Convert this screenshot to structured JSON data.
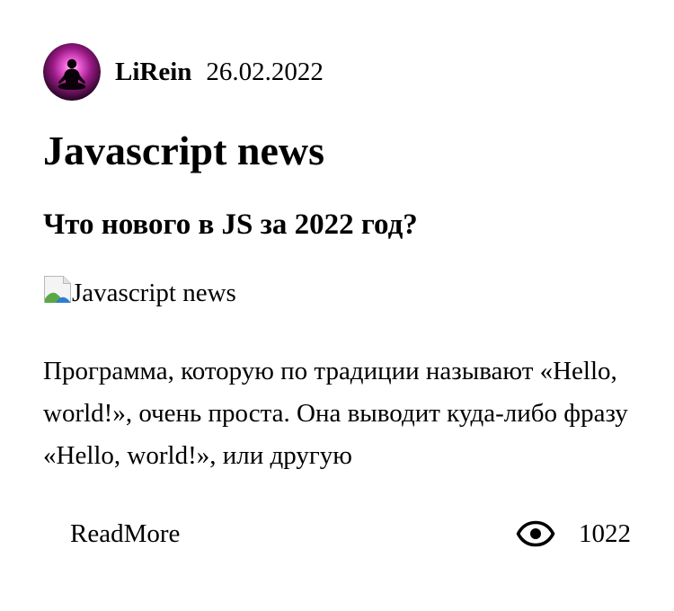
{
  "post": {
    "author": {
      "name": "LiRein",
      "avatar_icon": "meditating-person-avatar"
    },
    "date": "26.02.2022",
    "title": "Javascript news",
    "subtitle": "Что нового в JS за 2022 год?",
    "image": {
      "alt": "Javascript news",
      "icon": "broken-image-icon"
    },
    "excerpt": "Программа, которую по традиции называют «Hello, world!», очень проста. Она выводит куда-либо фразу «Hello, world!», или другую",
    "read_more_label": "ReadMore",
    "views": {
      "icon": "eye-icon",
      "count": "1022"
    }
  },
  "colors": {
    "text": "#000000",
    "background": "#ffffff",
    "avatar_glow": "#e040c8"
  }
}
